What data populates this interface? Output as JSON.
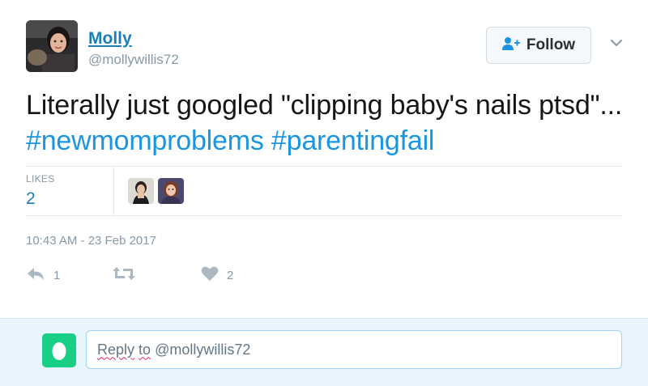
{
  "author": {
    "name": "Molly",
    "handle": "@mollywillis72"
  },
  "follow_button": {
    "label": "Follow",
    "icon": "add-user-icon"
  },
  "menu_icon": "chevron-down-icon",
  "tweet": {
    "text_plain": "Literally just googled \"clipping baby's nails ptsd\"...",
    "hashtags": [
      "#newmomproblems",
      "#parentingfail"
    ]
  },
  "stats": {
    "likes_label": "LIKES",
    "likes_count": "2"
  },
  "timestamp": "10:43 AM - 23 Feb 2017",
  "actions": {
    "reply_icon": "reply-icon",
    "reply_count": "1",
    "retweet_icon": "retweet-icon",
    "like_icon": "heart-icon",
    "like_count": "2"
  },
  "reply_box": {
    "word1": "Reply",
    "word2": "to",
    "handle": "@mollywillis72",
    "avatar_icon": "egg-avatar-icon"
  },
  "colors": {
    "link": "#1b7fb6",
    "hashtag": "#1b95e0",
    "muted": "#8899a6",
    "reply_bar_bg": "#e8f5fd",
    "egg_avatar": "#19cf86"
  }
}
